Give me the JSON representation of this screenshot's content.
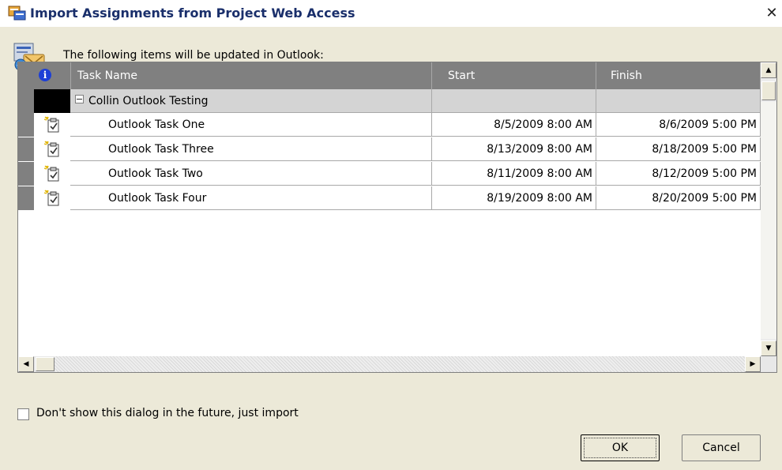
{
  "window": {
    "title": "Import Assignments from Project Web Access",
    "close_glyph": "✕"
  },
  "header": {
    "message": "The following items will be updated in Outlook:",
    "icon": "outlook-project-icon"
  },
  "grid": {
    "columns": {
      "info_glyph": "i",
      "task_name": "Task Name",
      "start": "Start",
      "finish": "Finish"
    },
    "group": {
      "name": "Collin Outlook Testing",
      "expanded": true
    },
    "rows": [
      {
        "name": "Outlook Task One",
        "start": "8/5/2009 8:00 AM",
        "finish": "8/6/2009 5:00 PM",
        "icon": "task-icon"
      },
      {
        "name": "Outlook Task Three",
        "start": "8/13/2009 8:00 AM",
        "finish": "8/18/2009 5:00 PM",
        "icon": "task-icon"
      },
      {
        "name": "Outlook Task Two",
        "start": "8/11/2009 8:00 AM",
        "finish": "8/12/2009 5:00 PM",
        "icon": "task-icon"
      },
      {
        "name": "Outlook Task Four",
        "start": "8/19/2009 8:00 AM",
        "finish": "8/20/2009 5:00 PM",
        "icon": "task-icon"
      }
    ]
  },
  "footer": {
    "checkbox_label": "Don't show this dialog in the future, just import",
    "checkbox_checked": false,
    "ok_label": "OK",
    "cancel_label": "Cancel"
  },
  "colors": {
    "header_bg": "#808080",
    "group_bg": "#d4d4d4",
    "dialog_bg": "#ece9d8"
  }
}
